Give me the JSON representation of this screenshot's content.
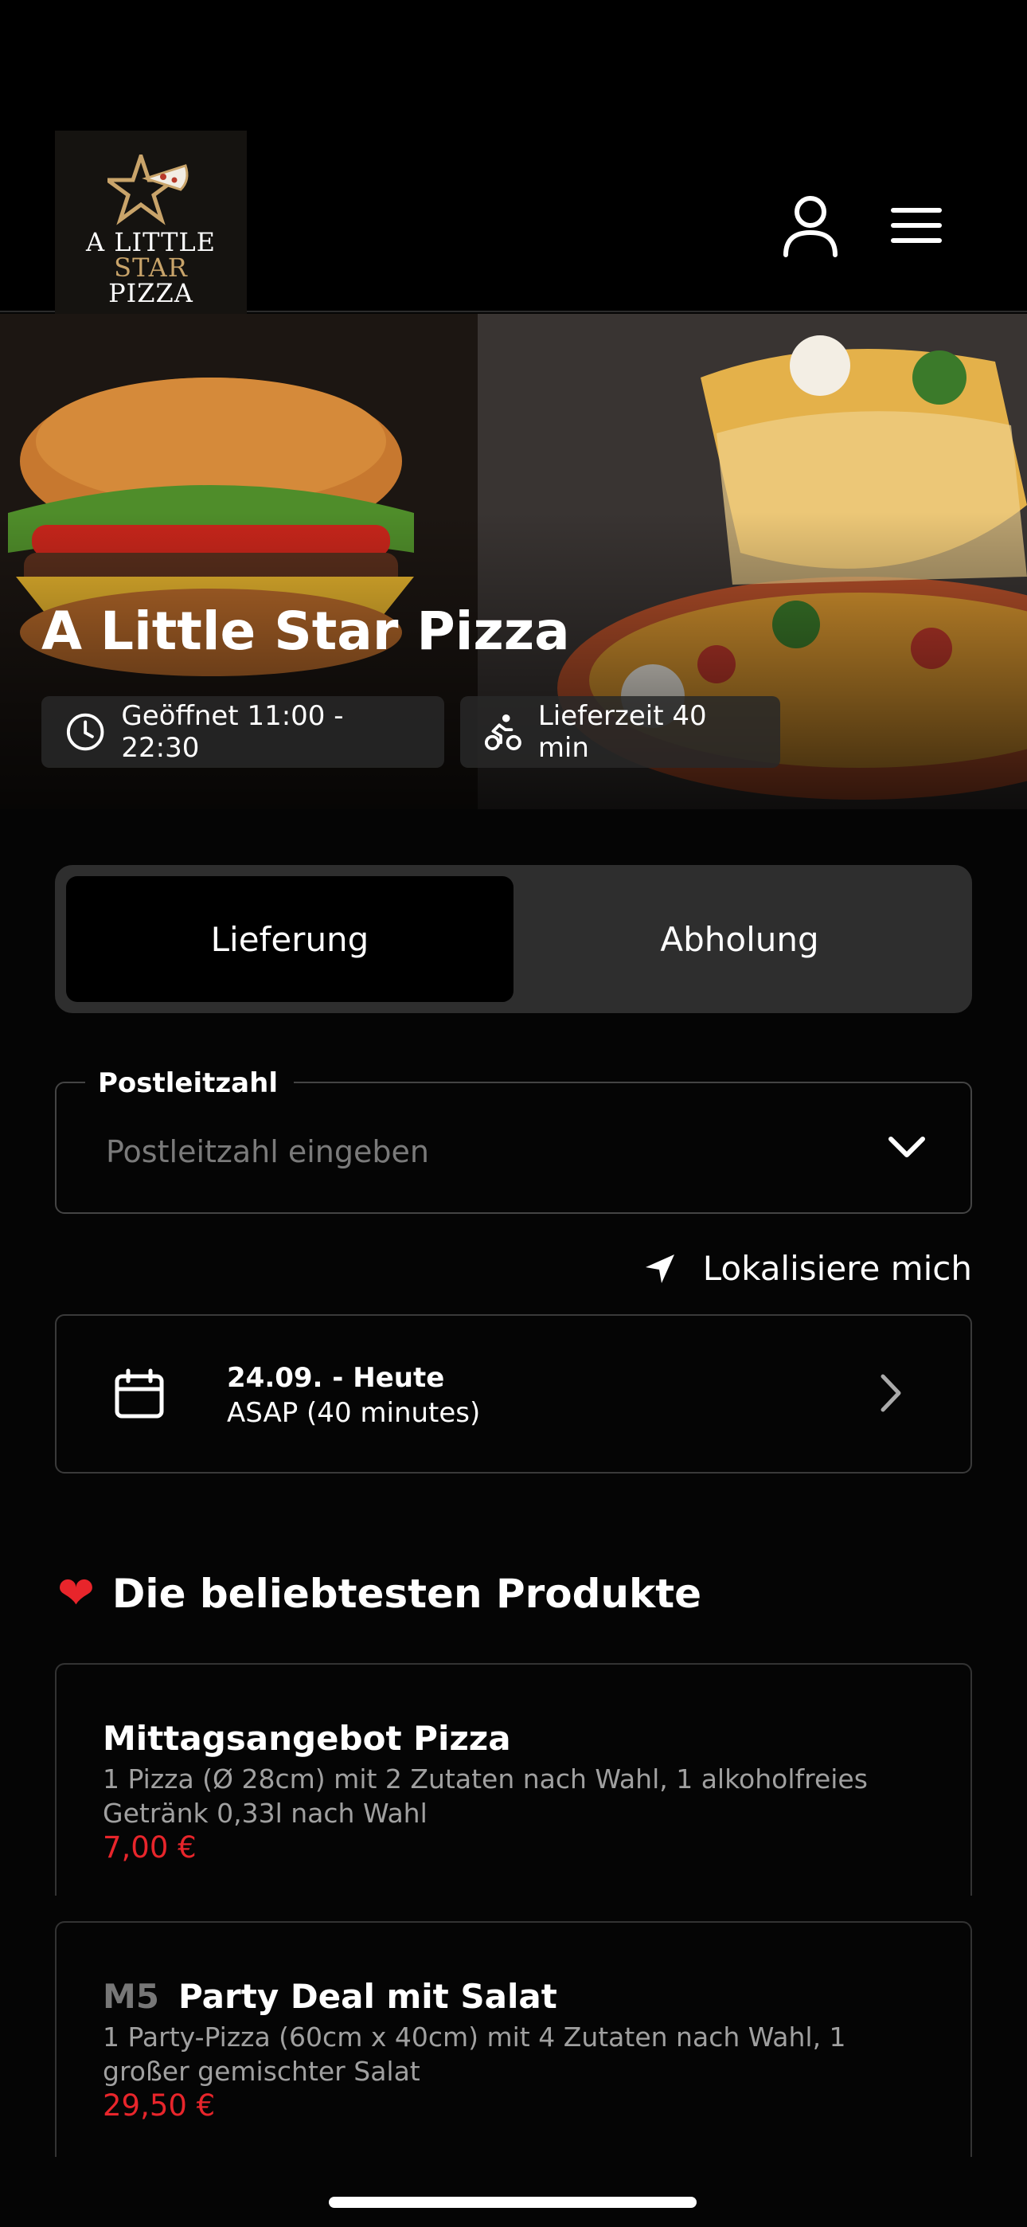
{
  "header": {
    "logo_lines": [
      "A LITTLE",
      "STAR",
      "PIZZA"
    ]
  },
  "hero": {
    "title": "A Little Star Pizza",
    "open_hours": "Geöffnet 11:00 - 22:30",
    "delivery_time": "Lieferzeit 40 min"
  },
  "order_mode": {
    "options": [
      "Lieferung",
      "Abholung"
    ],
    "selected": "Lieferung"
  },
  "zip": {
    "label": "Postleitzahl",
    "placeholder": "Postleitzahl eingeben",
    "value": ""
  },
  "locate_label": "Lokalisiere mich",
  "schedule": {
    "date": "24.09. - Heute",
    "time": "ASAP (40 minutes)"
  },
  "popular": {
    "heading": "Die beliebtesten Produkte",
    "products": [
      {
        "code": "",
        "name": "Mittagsangebot Pizza",
        "description": "1 Pizza (Ø 28cm) mit 2 Zutaten nach Wahl, 1 alkoholfreies Getränk 0,33l nach Wahl",
        "price": "7,00 €"
      },
      {
        "code": "M5",
        "name": "Party Deal mit Salat",
        "description": "1 Party-Pizza (60cm x 40cm) mit 4 Zutaten nach Wahl, 1 großer gemischter Salat",
        "price": "29,50 €"
      }
    ]
  },
  "colors": {
    "background": "#050505",
    "accent_price": "#e8252b",
    "logo_gold": "#c9a46a",
    "segment_bg": "#2e2e2e"
  }
}
